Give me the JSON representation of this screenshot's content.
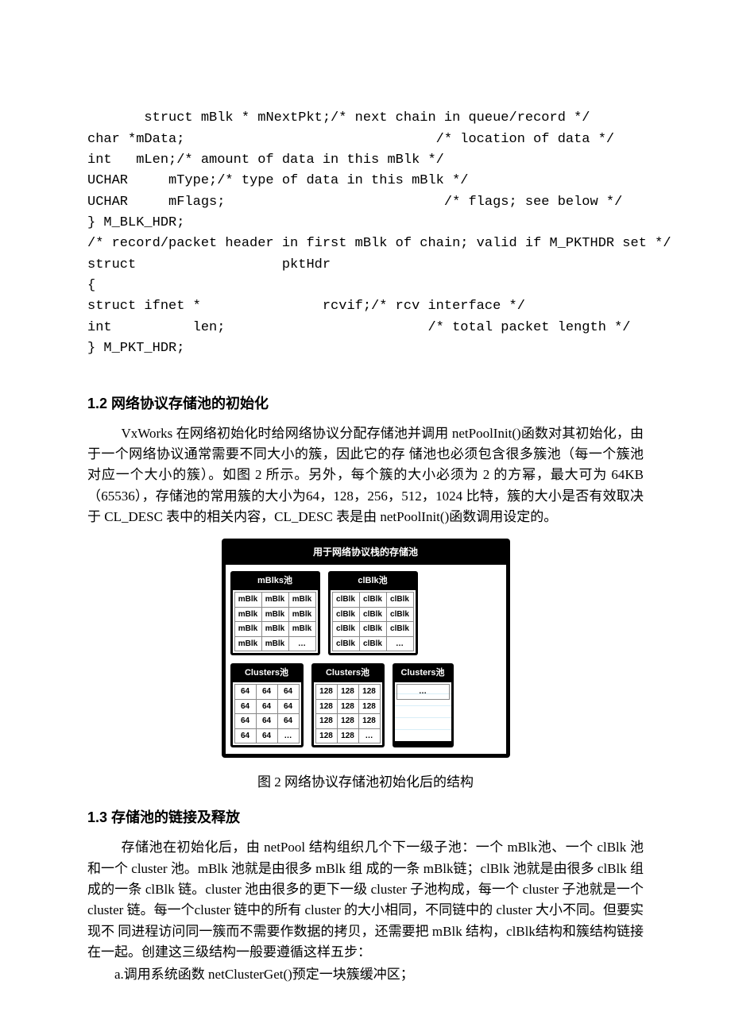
{
  "code_lines": [
    "   struct mBlk * mNextPkt;/* next chain in queue/record */",
    "char *mData;                               /* location of data */",
    "int   mLen;/* amount of data in this mBlk */",
    "UCHAR     mType;/* type of data in this mBlk */",
    "UCHAR     mFlags;                           /* flags; see below */",
    "} M_BLK_HDR;",
    "/* record/packet header in first mBlk of chain; valid if M_PKTHDR set */",
    "struct                  pktHdr",
    "{",
    "struct ifnet *               rcvif;/* rcv interface */",
    "int          len;                         /* total packet length */",
    "} M_PKT_HDR;"
  ],
  "h12": "1.2   网络协议存储池的初始化",
  "p12": "VxWorks 在网络初始化时给网络协议分配存储池并调用 netPoolInit()函数对其初始化，由于一个网络协议通常需要不同大小的簇，因此它的存 储池也必须包含很多簇池（每一个簇池对应一个大小的簇）。如图 2 所示。另外，每个簇的大小必须为 2 的方幂，最大可为 64KB（65536），存储池的常用簇的大小为64，128，256，512，1024 比特，簇的大小是否有效取决于 CL_DESC 表中的相关内容，CL_DESC 表是由 netPoolInit()函数调用设定的。",
  "fig2": {
    "main_title": "用于网络协议栈的存储池",
    "pool_mblks": {
      "title": "mBlks池",
      "rows": [
        [
          "mBlk",
          "mBlk",
          "mBlk"
        ],
        [
          "mBlk",
          "mBlk",
          "mBlk"
        ],
        [
          "mBlk",
          "mBlk",
          "mBlk"
        ],
        [
          "mBlk",
          "mBlk",
          "…"
        ]
      ]
    },
    "pool_clblk": {
      "title": "clBlk池",
      "rows": [
        [
          "clBlk",
          "clBlk",
          "clBlk"
        ],
        [
          "clBlk",
          "clBlk",
          "clBlk"
        ],
        [
          "clBlk",
          "clBlk",
          "clBlk"
        ],
        [
          "clBlk",
          "clBlk",
          "…"
        ]
      ]
    },
    "pool_c64": {
      "title": "Clusters池",
      "rows": [
        [
          "64",
          "64",
          "64"
        ],
        [
          "64",
          "64",
          "64"
        ],
        [
          "64",
          "64",
          "64"
        ],
        [
          "64",
          "64",
          "…"
        ]
      ]
    },
    "pool_c128": {
      "title": "Clusters池",
      "rows": [
        [
          "128",
          "128",
          "128"
        ],
        [
          "128",
          "128",
          "128"
        ],
        [
          "128",
          "128",
          "128"
        ],
        [
          "128",
          "128",
          "…"
        ]
      ]
    },
    "pool_cmore": {
      "title": "Clusters池",
      "rows": [
        [
          "…"
        ]
      ]
    }
  },
  "fig2_caption": "图 2     网络协议存储池初始化后的结构",
  "h13": "1.3   存储池的链接及释放",
  "p13a": "存储池在初始化后，由 netPool 结构组织几个下一级子池：一个 mBlk池、一个 clBlk 池和一个 cluster 池。mBlk 池就是由很多 mBlk 组 成的一条 mBlk链；clBlk 池就是由很多 clBlk 组成的一条 clBlk 链。cluster 池由很多的更下一级 cluster 子池构成，每一个 cluster 子池就是一个 cluster 链。每一个cluster 链中的所有 cluster 的大小相同，不同链中的 cluster 大小不同。但要实现不 同进程访问同一簇而不需要作数据的拷贝，还需要把 mBlk 结构，clBlk结构和簇结构链接在一起。创建这三级结构一般要遵循这样五步：",
  "p13b": "a.调用系统函数 netClusterGet()预定一块簇缓冲区；"
}
